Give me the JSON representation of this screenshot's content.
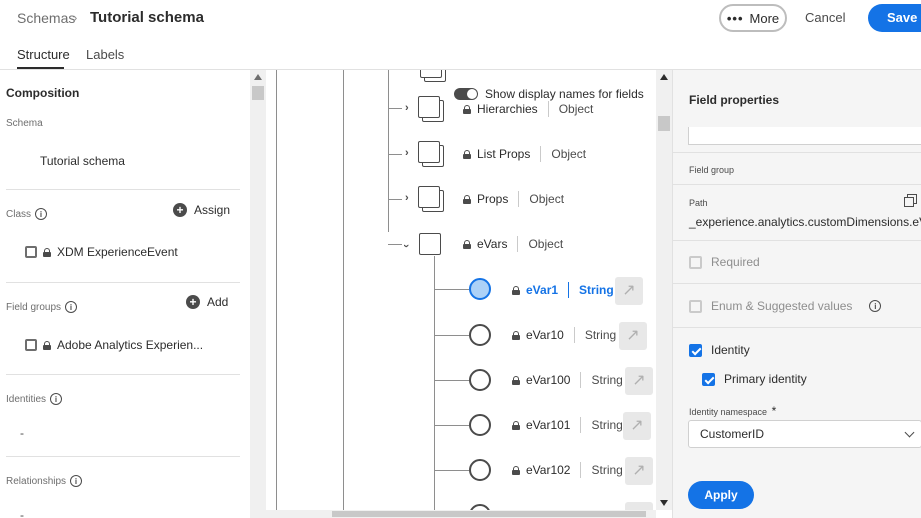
{
  "header": {
    "breadcrumb_root": "Schemas",
    "breadcrumb_sep": "›",
    "title": "Tutorial schema",
    "more_label": "More",
    "more_dots": "•••",
    "cancel_label": "Cancel",
    "save_label": "Save"
  },
  "tabs": [
    {
      "label": "Structure",
      "active": true
    },
    {
      "label": "Labels",
      "active": false
    }
  ],
  "composition": {
    "title": "Composition",
    "schema_label": "Schema",
    "schema_name": "Tutorial schema",
    "class_label": "Class",
    "assign_label": "Assign",
    "class_item": "XDM ExperienceEvent",
    "field_groups_label": "Field groups",
    "add_label": "Add",
    "field_group_item": "Adobe Analytics Experien...",
    "identities_label": "Identities",
    "identities_value": "-",
    "relationships_label": "Relationships",
    "relationships_value": "-"
  },
  "tree": {
    "toggle_label": "Show display names for fields",
    "nodes": [
      {
        "name": "Hierarchies",
        "type": "Object"
      },
      {
        "name": "List Props",
        "type": "Object"
      },
      {
        "name": "Props",
        "type": "Object"
      },
      {
        "name": "eVars",
        "type": "Object"
      }
    ],
    "fields": [
      {
        "name": "eVar1",
        "type": "String",
        "selected": true
      },
      {
        "name": "eVar10",
        "type": "String",
        "selected": false
      },
      {
        "name": "eVar100",
        "type": "String",
        "selected": false
      },
      {
        "name": "eVar101",
        "type": "String",
        "selected": false
      },
      {
        "name": "eVar102",
        "type": "String",
        "selected": false
      }
    ]
  },
  "field_properties": {
    "title": "Field properties",
    "field_group_label": "Field group",
    "path_label": "Path",
    "path_value": "_experience.analytics.customDimensions.eV...",
    "required_label": "Required",
    "enum_label": "Enum & Suggested values",
    "identity_label": "Identity",
    "identity_checked": true,
    "primary_identity_label": "Primary identity",
    "primary_identity_checked": true,
    "namespace_label": "Identity namespace",
    "namespace_required_mark": "*",
    "namespace_value": "CustomerID",
    "apply_label": "Apply"
  },
  "colors": {
    "accent": "#1473e6",
    "selected_radio_fill": "#acd1f7"
  }
}
